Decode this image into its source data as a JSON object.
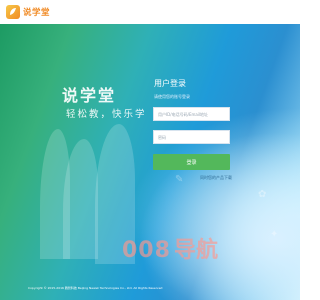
{
  "header": {
    "logo_text": "说学堂"
  },
  "brand": {
    "name": "说学堂",
    "slogan": "轻松教，快乐学"
  },
  "login": {
    "title": "用户登录",
    "hint": "请使用您的账号登录",
    "username_placeholder": "用户ID/电话号码/Email地址",
    "password_placeholder": "密码",
    "submit_label": "登录",
    "download_link": "同时您的产品下载"
  },
  "footer": {
    "copyright": "Copyright © 2015-2016 腾智科技 Beijing Newsk Technologies Co., Ltd. All Rights Reserved"
  },
  "watermark": {
    "digits": "008",
    "text": "导航"
  },
  "colors": {
    "accent": "#53b85b",
    "logo": "#f08a24"
  }
}
